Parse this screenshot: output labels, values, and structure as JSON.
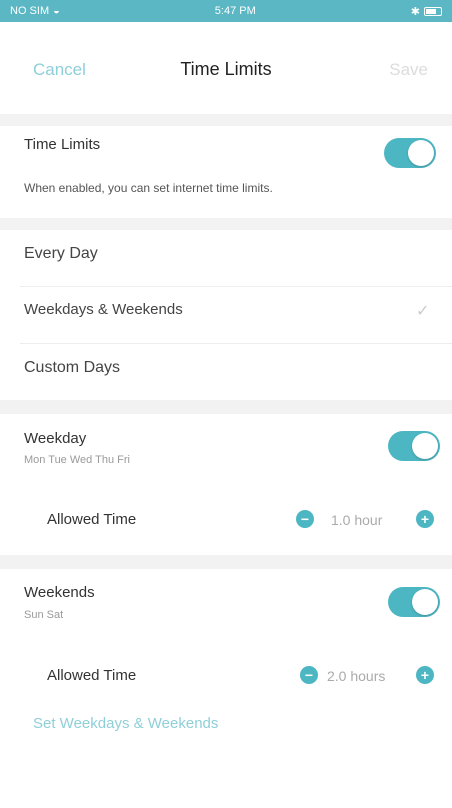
{
  "status": {
    "carrier": "NO SIM",
    "time": "5:47 PM"
  },
  "nav": {
    "cancel": "Cancel",
    "title": "Time Limits",
    "save": "Save"
  },
  "time_limits": {
    "label": "Time Limits",
    "enabled": true,
    "description": "When enabled, you can set internet time limits."
  },
  "modes": [
    {
      "label": "Every Day",
      "selected": false
    },
    {
      "label": "Weekdays & Weekends",
      "selected": true
    },
    {
      "label": "Custom Days",
      "selected": false
    }
  ],
  "weekday": {
    "label": "Weekday",
    "days": "Mon Tue Wed Thu Fri",
    "enabled": true,
    "allowed_label": "Allowed Time",
    "allowed_value": "1.0 hour"
  },
  "weekends": {
    "label": "Weekends",
    "days": "Sun Sat",
    "enabled": true,
    "allowed_label": "Allowed Time",
    "allowed_value": "2.0 hours"
  },
  "link": "Set Weekdays & Weekends",
  "colors": {
    "accent": "#4db6c3",
    "status_bar": "#5bb7c3",
    "link": "#8fcfd8"
  }
}
